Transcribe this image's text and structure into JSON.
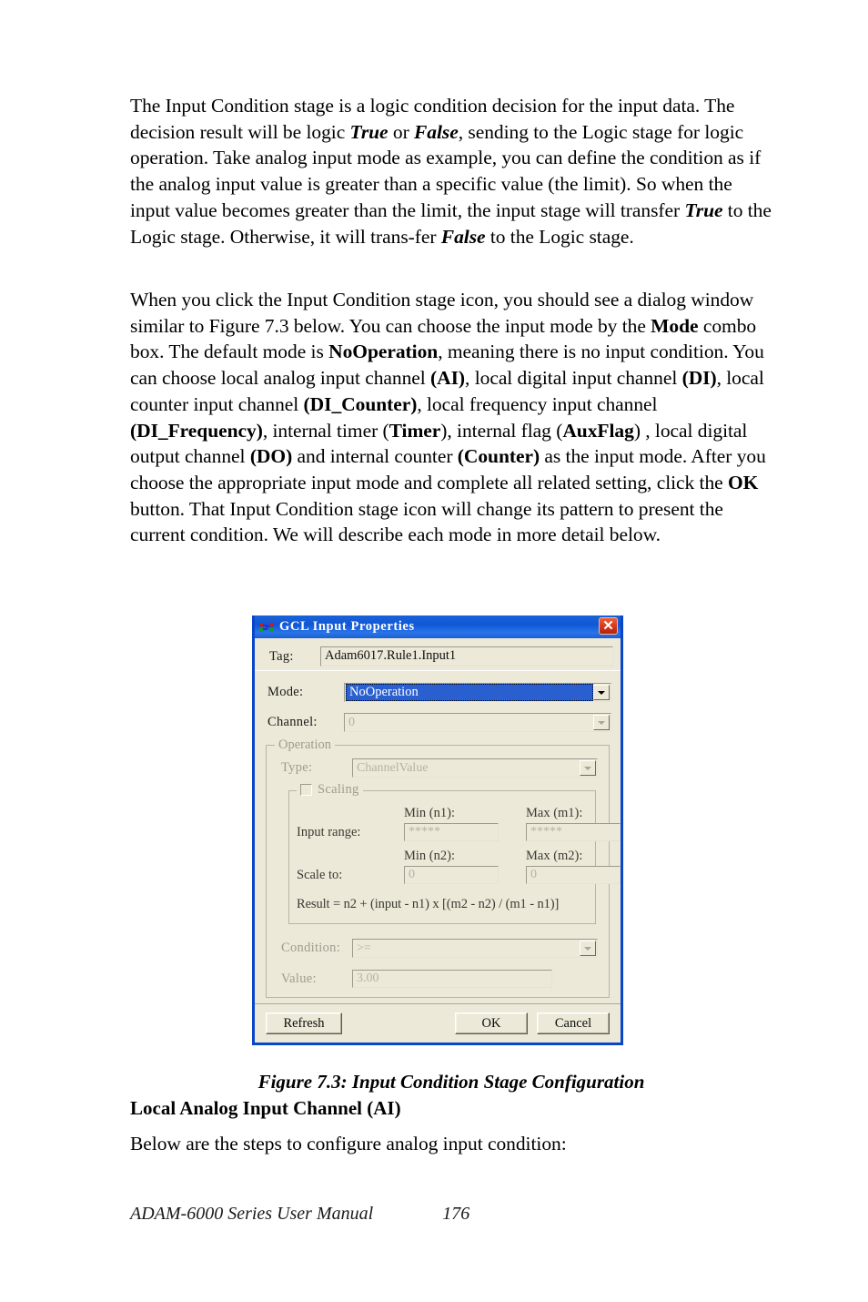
{
  "document": {
    "paragraph_1": {
      "segments": [
        {
          "text": "The Input Condition stage is a logic condition decision for the input data. The decision result will be logic ",
          "style": "normal"
        },
        {
          "text": "True",
          "style": "bold-italic"
        },
        {
          "text": " or ",
          "style": "normal"
        },
        {
          "text": "False",
          "style": "bold-italic"
        },
        {
          "text": ", sending to the Logic stage for logic operation. Take analog input mode as example, you can define the condition as if the analog input value is greater than a specific value (the limit). So when the input value becomes greater than the limit, the input stage will transfer ",
          "style": "normal"
        },
        {
          "text": "True",
          "style": "bold-italic"
        },
        {
          "text": " to the Logic stage. Otherwise, it will trans-fer ",
          "style": "normal"
        },
        {
          "text": "False",
          "style": "bold-italic"
        },
        {
          "text": " to the Logic stage.",
          "style": "normal"
        }
      ]
    },
    "paragraph_2": {
      "segments": [
        {
          "text": "When you click the Input Condition stage icon, you should see a dialog window similar to Figure 7.3 below. You can choose the input mode by the ",
          "style": "normal"
        },
        {
          "text": "Mode",
          "style": "bold"
        },
        {
          "text": " combo box. The default mode is ",
          "style": "normal"
        },
        {
          "text": "NoOperation",
          "style": "bold"
        },
        {
          "text": ", meaning there is no input condition. You can choose local analog input channel ",
          "style": "normal"
        },
        {
          "text": "(AI)",
          "style": "bold"
        },
        {
          "text": ", local digital input channel ",
          "style": "normal"
        },
        {
          "text": "(DI)",
          "style": "bold"
        },
        {
          "text": ", local counter input channel ",
          "style": "normal"
        },
        {
          "text": "(DI_Counter)",
          "style": "bold"
        },
        {
          "text": ", local frequency input channel ",
          "style": "normal"
        },
        {
          "text": "(DI_Frequency)",
          "style": "bold"
        },
        {
          "text": ", internal timer (",
          "style": "normal"
        },
        {
          "text": "Timer",
          "style": "bold"
        },
        {
          "text": "), internal flag (",
          "style": "normal"
        },
        {
          "text": "AuxFlag",
          "style": "bold"
        },
        {
          "text": ") , local digital output channel ",
          "style": "normal"
        },
        {
          "text": "(DO)",
          "style": "bold"
        },
        {
          "text": " and internal counter ",
          "style": "normal"
        },
        {
          "text": "(Counter)",
          "style": "bold"
        },
        {
          "text": " as the input mode. After you choose the appropriate input mode and complete all related setting, click the ",
          "style": "normal"
        },
        {
          "text": "OK",
          "style": "bold"
        },
        {
          "text": " button. That Input Condition stage icon will change its pattern to present the current condition. We will describe each mode in more detail below.",
          "style": "normal"
        }
      ]
    },
    "figure_caption": "Figure 7.3: Input Condition Stage Configuration",
    "subheading": "Local Analog Input Channel (AI)",
    "paragraph_3": "Below are the steps to configure analog input condition:",
    "footer": {
      "manual": "ADAM-6000 Series User Manual",
      "page_number": "176"
    }
  },
  "dialog": {
    "title": "GCL Input Properties",
    "title_icon": "gcl-connector-icon",
    "close_icon": "close-icon",
    "tag": {
      "label": "Tag:",
      "value": "Adam6017.Rule1.Input1"
    },
    "mode": {
      "label": "Mode:",
      "value": "NoOperation",
      "state": "focused-selected"
    },
    "channel": {
      "label": "Channel:",
      "value": "0",
      "state": "disabled"
    },
    "operation": {
      "group_title": "Operation",
      "type": {
        "label": "Type:",
        "value": "ChannelValue",
        "state": "disabled"
      },
      "scaling": {
        "group_title": "Scaling",
        "checked": false,
        "state": "disabled",
        "headers_row1": {
          "min": "Min (n1):",
          "max": "Max (m1):"
        },
        "input_range": {
          "label": "Input range:",
          "min_value": "*****",
          "max_value": "*****"
        },
        "headers_row2": {
          "min": "Min (n2):",
          "max": "Max (m2):"
        },
        "scale_to": {
          "label": "Scale to:",
          "min_value": "0",
          "max_value": "0"
        },
        "formula": "Result = n2 + (input - n1) x [(m2 - n2) / (m1 - n1)]"
      },
      "condition": {
        "label": "Condition:",
        "value": ">=",
        "state": "disabled"
      },
      "value": {
        "label": "Value:",
        "value": "3.00",
        "state": "disabled"
      }
    },
    "buttons": {
      "refresh": "Refresh",
      "ok": "OK",
      "cancel": "Cancel"
    }
  },
  "colors": {
    "titlebar_blue": "#1157d6",
    "dialog_face": "#ece9d8",
    "selection_blue": "#2a5fd0",
    "close_red": "#d83a1c",
    "disabled_text": "#b6b3a6",
    "border_blue": "#0a46c8"
  }
}
